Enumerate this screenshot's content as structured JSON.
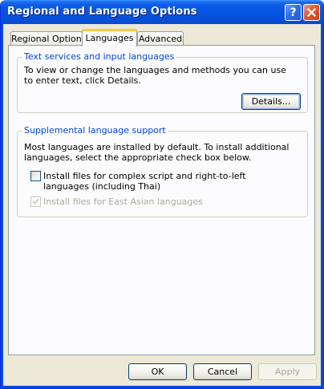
{
  "window": {
    "title": "Regional and Language Options",
    "help_glyph": "?",
    "close_glyph": "✕"
  },
  "tabs": [
    {
      "label": "Regional Options",
      "active": false
    },
    {
      "label": "Languages",
      "active": true
    },
    {
      "label": "Advanced",
      "active": false
    }
  ],
  "text_services": {
    "title": "Text services and input languages",
    "description": "To view or change the languages and methods you can use to enter text, click Details.",
    "details_button": "Details..."
  },
  "supplemental": {
    "title": "Supplemental language support",
    "description": "Most languages are installed by default. To install additional languages, select the appropriate check box below.",
    "complex_script_label": "Install files for complex script and right-to-left languages (including Thai)",
    "complex_script_checked": false,
    "east_asian_label": "Install files for East Asian languages",
    "east_asian_checked": true,
    "east_asian_enabled": false
  },
  "footer": {
    "ok": "OK",
    "cancel": "Cancel",
    "apply": "Apply",
    "apply_enabled": false
  },
  "colors": {
    "title_bar": "#0554e0",
    "group_title": "#0046d5",
    "tab_highlight": "#ffc83c",
    "dialog_bg": "#ece9d8"
  }
}
